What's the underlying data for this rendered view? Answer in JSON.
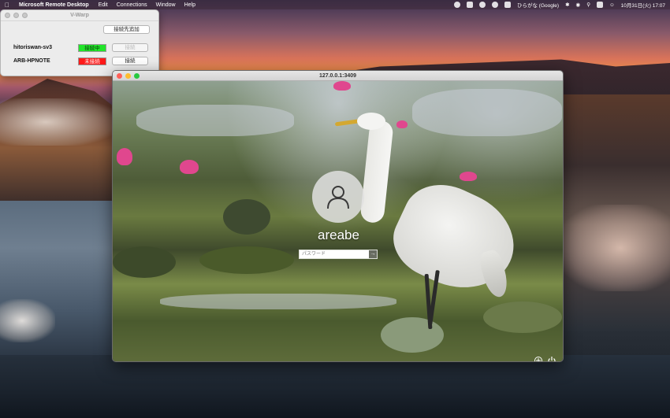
{
  "menubar": {
    "app_name": "Microsoft Remote Desktop",
    "menus": [
      "Edit",
      "Connections",
      "Window",
      "Help"
    ],
    "input_method": "ひらがな (Google)",
    "datetime": "10月31日(火)  17:07"
  },
  "vwarp": {
    "title": "V-Warp",
    "add_connection_label": "接続先追加",
    "hosts": [
      {
        "name": "hitoriswan-sv3",
        "status": "接続中",
        "button": "接続",
        "status_color": "#22e52a"
      },
      {
        "name": "ARB-HPNOTE",
        "status": "未接続",
        "button": "接続",
        "status_color": "#ff1a1a"
      }
    ]
  },
  "rdp": {
    "title": "127.0.0.1:3409",
    "username": "areabe",
    "password_placeholder": "パスワード",
    "submit_symbol": "→"
  },
  "icons": [
    "apple-icon",
    "wifi-icon",
    "bluetooth-icon",
    "search-icon",
    "control-center-icon",
    "accessibility-icon",
    "power-icon",
    "user-icon"
  ]
}
